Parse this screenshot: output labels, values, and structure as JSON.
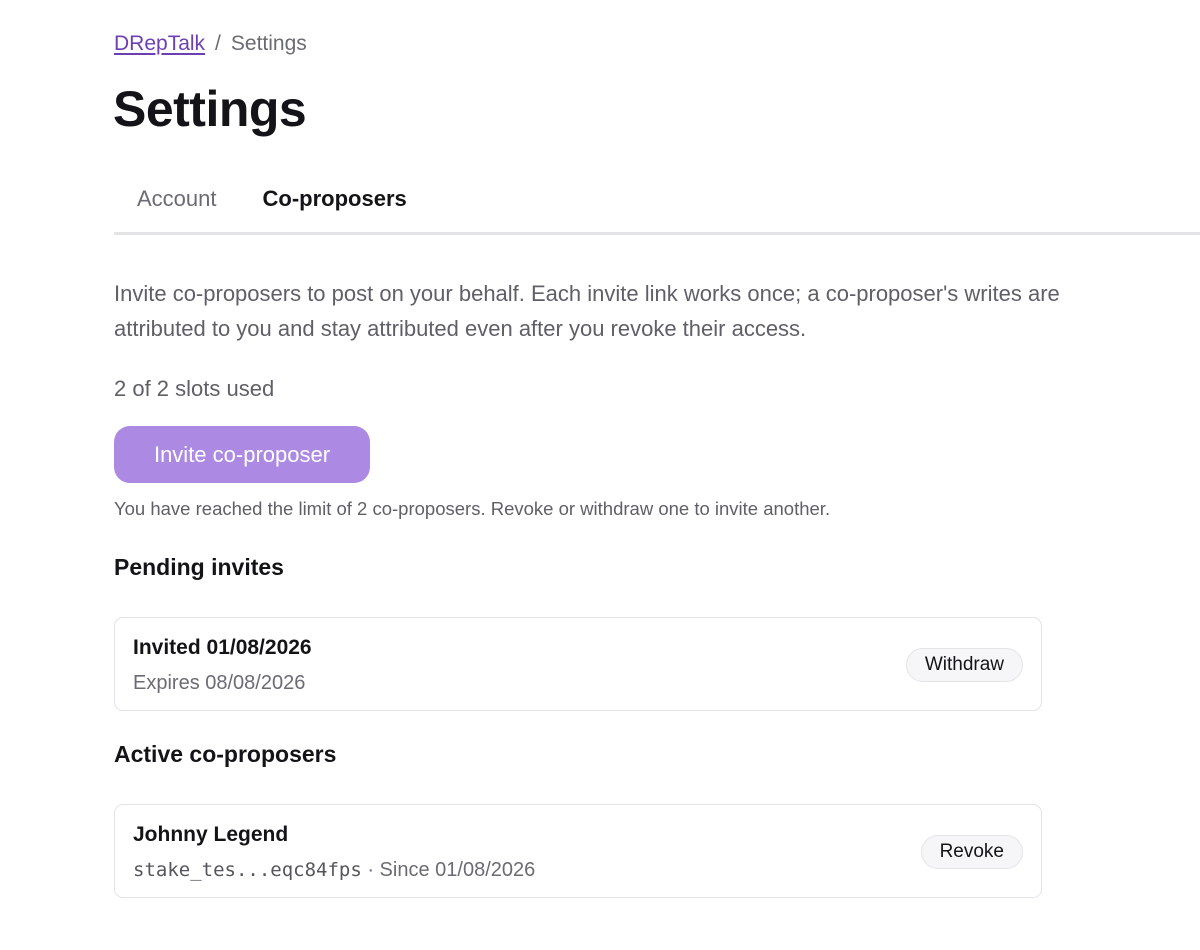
{
  "breadcrumb": {
    "home": "DRepTalk",
    "separator": "/",
    "current": "Settings"
  },
  "page": {
    "title": "Settings"
  },
  "tabs": [
    {
      "label": "Account",
      "active": false
    },
    {
      "label": "Co-proposers",
      "active": true
    }
  ],
  "coproposers": {
    "description": "Invite co-proposers to post on your behalf. Each invite link works once; a co-proposer's writes are attributed to you and stay attributed even after you revoke their access.",
    "slots_text": "2 of 2 slots used",
    "invite_button": "Invite co-proposer",
    "limit_note": "You have reached the limit of 2 co-proposers. Revoke or withdraw one to invite another."
  },
  "pending": {
    "heading": "Pending invites",
    "items": [
      {
        "title": "Invited 01/08/2026",
        "subtitle": "Expires 08/08/2026",
        "action": "Withdraw"
      }
    ]
  },
  "active": {
    "heading": "Active co-proposers",
    "items": [
      {
        "name": "Johnny Legend",
        "stake": "stake_tes...eqc84fps",
        "since": "· Since 01/08/2026",
        "action": "Revoke"
      }
    ]
  },
  "colors": {
    "accent": "#6d3fb5",
    "button_disabled": "#ac8ae3",
    "border": "#e4e4e8"
  }
}
